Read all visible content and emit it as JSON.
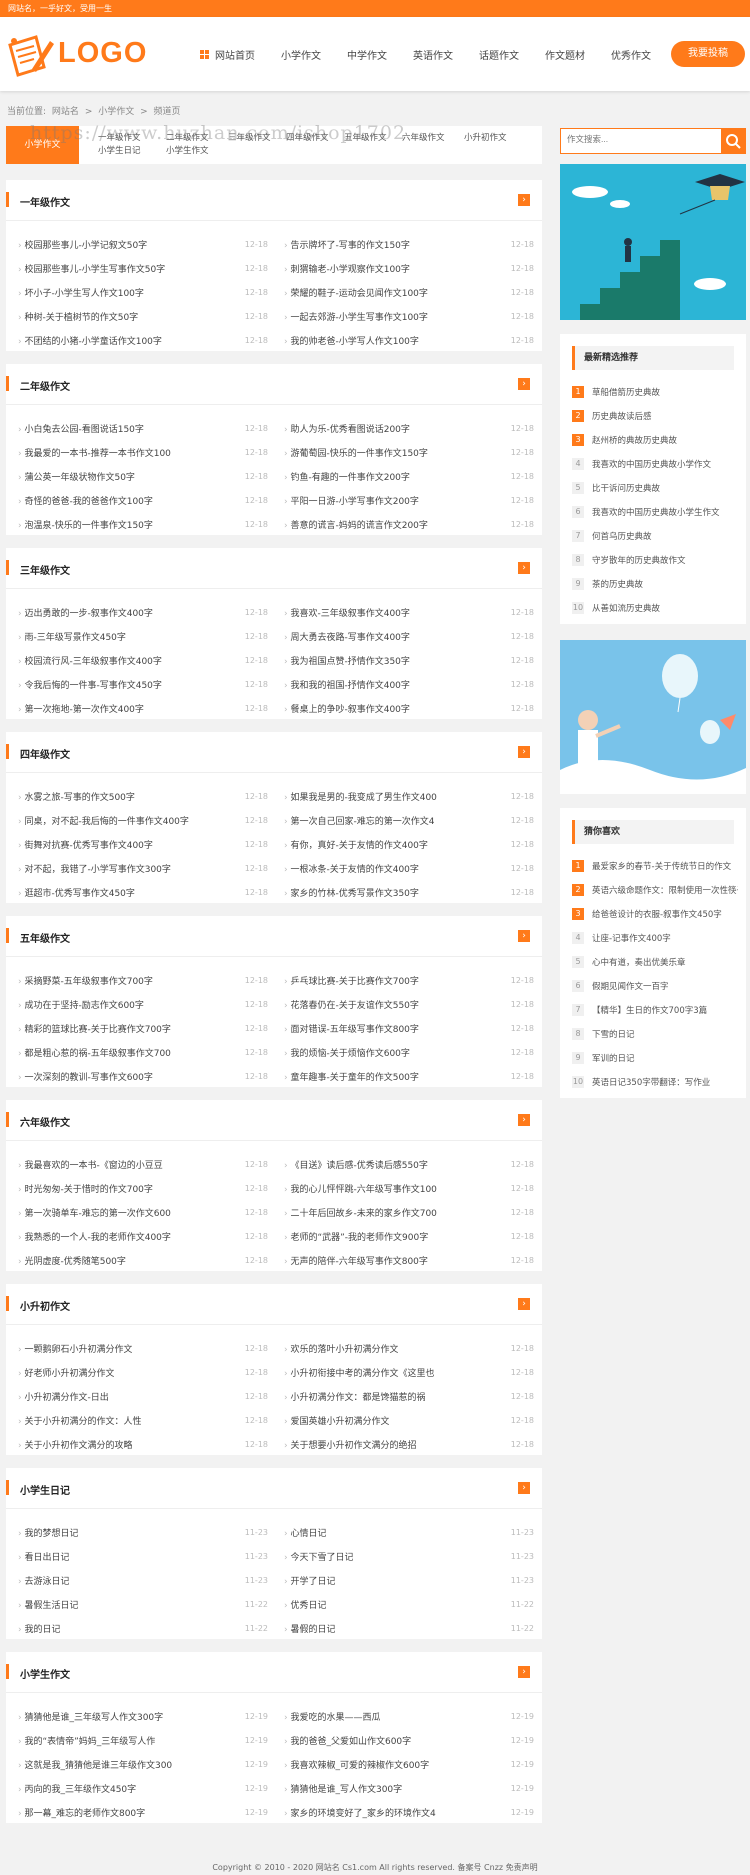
{
  "topbar": {
    "text": "网站名，一乎好文，受用一生"
  },
  "logo": {
    "text": "LOGO"
  },
  "nav": {
    "home": "网站首页",
    "items": [
      "小学作文",
      "中学作文",
      "英语作文",
      "话题作文",
      "作文题材",
      "优秀作文"
    ],
    "submit": "我要投稿"
  },
  "breadcrumb": {
    "prefix": "当前位置:",
    "site": "网站名",
    "cat": "小学作文",
    "page": "频道页",
    "sep": ">"
  },
  "subnav": {
    "active": "小学作文",
    "items": [
      "一年级作文",
      "二年级作文",
      "三年级作文",
      "四年级作文",
      "五年级作文",
      "六年级作文",
      "小升初作文"
    ],
    "items2": [
      "小学生日记",
      "小学生作文"
    ]
  },
  "watermark": "https://www.huzhan.com/ishop1702",
  "search": {
    "placeholder": "作文搜索..."
  },
  "sections": [
    {
      "title": "一年级作文",
      "more": "›",
      "left": [
        [
          "校园那些事儿-小学记叙文50字",
          "12-18"
        ],
        [
          "校园那些事儿-小学生写事作文50字",
          "12-18"
        ],
        [
          "坏小子-小学生写人作文100字",
          "12-18"
        ],
        [
          "种树-关于植树节的作文50字",
          "12-18"
        ],
        [
          "不团结的小猪-小学童话作文100字",
          "12-18"
        ]
      ],
      "right": [
        [
          "告示牌坏了-写事的作文150字",
          "12-18"
        ],
        [
          "刺猬输老-小学观察作文100字",
          "12-18"
        ],
        [
          "荣耀的鞋子-运动会见闻作文100字",
          "12-18"
        ],
        [
          "一起去郊游-小学生写事作文100字",
          "12-18"
        ],
        [
          "我的帅老爸-小学写人作文100字",
          "12-18"
        ]
      ]
    },
    {
      "title": "二年级作文",
      "more": "›",
      "left": [
        [
          "小白兔去公园-看图说话150字",
          "12-18"
        ],
        [
          "我最爱的一本书-推荐一本书作文100",
          "12-18"
        ],
        [
          "蒲公英一年级状物作文50字",
          "12-18"
        ],
        [
          "奇怪的爸爸-我的爸爸作文100字",
          "12-18"
        ],
        [
          "泡温泉-快乐的一件事作文150字",
          "12-18"
        ]
      ],
      "right": [
        [
          "助人为乐-优秀看图说话200字",
          "12-18"
        ],
        [
          "游葡萄园-快乐的一件事作文150字",
          "12-18"
        ],
        [
          "钓鱼-有趣的一件事作文200字",
          "12-18"
        ],
        [
          "平阳一日游-小学写事作文200字",
          "12-18"
        ],
        [
          "善意的谎言-妈妈的谎言作文200字",
          "12-18"
        ]
      ]
    },
    {
      "title": "三年级作文",
      "more": "›",
      "left": [
        [
          "迈出勇敢的一步-叙事作文400字",
          "12-18"
        ],
        [
          "雨-三年级写景作文450字",
          "12-18"
        ],
        [
          "校园流行风-三年级叙事作文400字",
          "12-18"
        ],
        [
          "令我后悔的一件事-写事作文450字",
          "12-18"
        ],
        [
          "第一次拖地-第一次作文400字",
          "12-18"
        ]
      ],
      "right": [
        [
          "我喜欢-三年级叙事作文400字",
          "12-18"
        ],
        [
          "周大勇去夜路-写事作文400字",
          "12-18"
        ],
        [
          "我为祖国点赞-抒情作文350字",
          "12-18"
        ],
        [
          "我和我的祖国-抒情作文400字",
          "12-18"
        ],
        [
          "餐桌上的争吵-叙事作文400字",
          "12-18"
        ]
      ]
    },
    {
      "title": "四年级作文",
      "more": "›",
      "left": [
        [
          "水雾之旅-写事的作文500字",
          "12-18"
        ],
        [
          "同桌，对不起-我后悔的一件事作文400字",
          "12-18"
        ],
        [
          "街舞对抗赛-优秀写事作文400字",
          "12-18"
        ],
        [
          "对不起，我错了-小学写事作文300字",
          "12-18"
        ],
        [
          "逛超市-优秀写事作文450字",
          "12-18"
        ]
      ],
      "right": [
        [
          "如果我是男的-我变成了男生作文400",
          "12-18"
        ],
        [
          "第一次自己回家-难忘的第一次作文4",
          "12-18"
        ],
        [
          "有你，真好-关于友情的作文400字",
          "12-18"
        ],
        [
          "一根冰条-关于友情的作文400字",
          "12-18"
        ],
        [
          "家乡的竹林-优秀写景作文350字",
          "12-18"
        ]
      ]
    },
    {
      "title": "五年级作文",
      "more": "›",
      "left": [
        [
          "采摘野菜-五年级叙事作文700字",
          "12-18"
        ],
        [
          "成功在于坚持-励志作文600字",
          "12-18"
        ],
        [
          "精彩的篮球比赛-关于比赛作文700字",
          "12-18"
        ],
        [
          "都是粗心惹的祸-五年级叙事作文700",
          "12-18"
        ],
        [
          "一次深刻的教训-写事作文600字",
          "12-18"
        ]
      ],
      "right": [
        [
          "乒乓球比赛-关于比赛作文700字",
          "12-18"
        ],
        [
          "花落春仍在-关于友谊作文550字",
          "12-18"
        ],
        [
          "面对错误-五年级写事作文800字",
          "12-18"
        ],
        [
          "我的烦恼-关于烦恼作文600字",
          "12-18"
        ],
        [
          "童年趣事-关于童年的作文500字",
          "12-18"
        ]
      ]
    },
    {
      "title": "六年级作文",
      "more": "›",
      "left": [
        [
          "我最喜欢的一本书-《窗边的小豆豆",
          "12-18"
        ],
        [
          "时光匆匆-关于惜时的作文700字",
          "12-18"
        ],
        [
          "第一次骑单车-难忘的第一次作文600",
          "12-18"
        ],
        [
          "我熟悉的一个人-我的老师作文400字",
          "12-18"
        ],
        [
          "光阴虚度-优秀随笔500字",
          "12-18"
        ]
      ],
      "right": [
        [
          "《目送》读后感-优秀读后感550字",
          "12-18"
        ],
        [
          "我的心儿怦怦跳-六年级写事作文100",
          "12-18"
        ],
        [
          "二十年后回故乡-未来的家乡作文700",
          "12-18"
        ],
        [
          "老师的“武器”-我的老师作文900字",
          "12-18"
        ],
        [
          "无声的陪伴-六年级写事作文800字",
          "12-18"
        ]
      ]
    },
    {
      "title": "小升初作文",
      "more": "›",
      "left": [
        [
          "一颗鹅卵石小升初满分作文",
          "12-18"
        ],
        [
          "好老师小升初满分作文",
          "12-18"
        ],
        [
          "小升初满分作文-日出",
          "12-18"
        ],
        [
          "关于小升初满分的作文：人性",
          "12-18"
        ],
        [
          "关于小升初作文满分的攻略",
          "12-18"
        ]
      ],
      "right": [
        [
          "欢乐的落叶小升初满分作文",
          "12-18"
        ],
        [
          "小升初衔接中考的满分作文《这里也",
          "12-18"
        ],
        [
          "小升初满分作文：都是馋猫惹的祸",
          "12-18"
        ],
        [
          "爱国英雄小升初满分作文",
          "12-18"
        ],
        [
          "关于想要小升初作文满分的绝招",
          "12-18"
        ]
      ]
    },
    {
      "title": "小学生日记",
      "more": "›",
      "left": [
        [
          "我的梦想日记",
          "11-23"
        ],
        [
          "看日出日记",
          "11-23"
        ],
        [
          "去游泳日记",
          "11-23"
        ],
        [
          "暑假生活日记",
          "11-22"
        ],
        [
          "我的日记",
          "11-22"
        ]
      ],
      "right": [
        [
          "心情日记",
          "11-23"
        ],
        [
          "今天下雪了日记",
          "11-23"
        ],
        [
          "开学了日记",
          "11-23"
        ],
        [
          "优秀日记",
          "11-22"
        ],
        [
          "暑假的日记",
          "11-22"
        ]
      ]
    },
    {
      "title": "小学生作文",
      "more": "›",
      "left": [
        [
          "猜猜他是谁_三年级写人作文300字",
          "12-19"
        ],
        [
          "我的“表情帝”妈妈_三年级写人作",
          "12-19"
        ],
        [
          "这就是我_猜猜他是谁三年级作文300",
          "12-19"
        ],
        [
          "丙向的我_三年级作文450字",
          "12-19"
        ],
        [
          "那一幕_难忘的老师作文800字",
          "12-19"
        ]
      ],
      "right": [
        [
          "我爱吃的水果——西瓜",
          "12-19"
        ],
        [
          "我的爸爸_父爱如山作文600字",
          "12-19"
        ],
        [
          "我喜欢辣椒_可爱的辣椒作文600字",
          "12-19"
        ],
        [
          "猜猜他是谁_写人作文300字",
          "12-19"
        ],
        [
          "家乡的环境变好了_家乡的环境作文4",
          "12-19"
        ]
      ]
    }
  ],
  "recommend": {
    "title": "最新精选推荐",
    "items": [
      "草船借箭历史典故",
      "历史典故读后感",
      "赵州桥的典故历史典故",
      "我喜欢的中国历史典故小学作文",
      "比干诉问历史典故",
      "我喜欢的中国历史典故小学生作文",
      "何首乌历史典故",
      "守岁散年的历史典故作文",
      "茶的历史典故",
      "从善如流历史典故"
    ]
  },
  "guess": {
    "title": "猜你喜欢",
    "items": [
      "最爱家乡的春节-关于传统节日的作文",
      "英语六级命题作文：限制使用一次性筷子",
      "给爸爸设计的衣服-叙事作文450字",
      "让座-记事作文400字",
      "心中有道，奏出优美乐章",
      "假期见闻作文一百字",
      "【精华】生日的作文700字3篇",
      "下雪的日记",
      "军训的日记",
      "英语日记350字带翻译：写作业"
    ]
  },
  "footer": {
    "text": "Copyright © 2010 - 2020 网站名 Cs1.com All rights reserved. 备案号 Cnzz 免责声明"
  }
}
